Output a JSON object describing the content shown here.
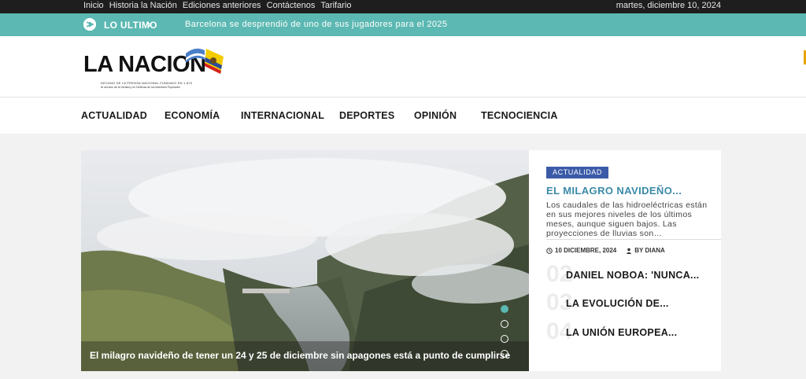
{
  "topbar": {
    "links": [
      "Inicio",
      "Historia la Nación",
      "Ediciones anteriores",
      "Contáctenos",
      "Tarifario"
    ],
    "date": "martes, diciembre 10, 2024"
  },
  "ticker": {
    "label": "LO ULTIMO",
    "chevron": "›",
    "headline": "Barcelona se desprendió de uno de sus jugadores para el 2025"
  },
  "logo": {
    "name": "LA NACION",
    "tagline1": "DECANO DE LA PRENSA NACIONAL FUNDADO EN 1.879",
    "tagline2": "Al servicio de la Verdad y en Defensa de los Intereses Populares"
  },
  "nav": {
    "items": [
      "ACTUALIDAD",
      "ECONOMÍA",
      "INTERNACIONAL",
      "DEPORTES",
      "OPINIÓN",
      "TECNOCIENCIA"
    ]
  },
  "hero": {
    "caption": "El milagro navideño de tener un 24 y 25 de diciembre sin apagones está a punto de cumplirse",
    "slides_total": 4,
    "active_slide": 1
  },
  "featured": {
    "category": "ACTUALIDAD",
    "title": "EL MILAGRO NAVIDEÑO...",
    "excerpt": "Los caudales de las hidroeléctricas están en sus mejores niveles de los últimos meses, aunque siguen bajos. Las proyecciones de lluvias son…",
    "date": "10 DICIEMBRE, 2024",
    "author": "BY DIANA",
    "clock_icon": "clock-icon",
    "user_icon": "user-icon"
  },
  "related": [
    {
      "num": "02",
      "title": "DANIEL NOBOA: 'NUNCA..."
    },
    {
      "num": "03",
      "title": "LA EVOLUCIÓN DE..."
    },
    {
      "num": "04",
      "title": "LA UNIÓN EUROPEA..."
    }
  ],
  "colors": {
    "accent": "#5cb8b2",
    "badge": "#3b5ba8",
    "title": "#3b8aa8",
    "topbar": "#1e1e1e"
  }
}
